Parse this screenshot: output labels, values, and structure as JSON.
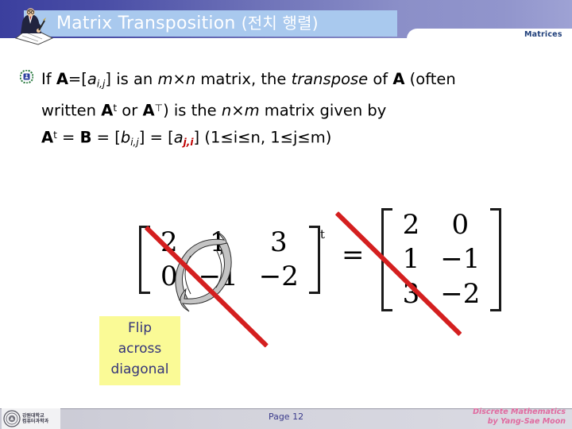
{
  "header": {
    "title_en": "Matrix Transposition",
    "title_ko": "(전치 행렬)",
    "section_label": "Matrices",
    "person_icon_name": "person-writing-icon",
    "bar_color": "#a9c9ee",
    "band_color": "#4a4ea6"
  },
  "body": {
    "bullet_icon_name": "globe-emblem-bullet-icon",
    "line1": {
      "t1": "If ",
      "A": "A",
      "eq": "=[",
      "a": "a",
      "sub": "i,j",
      "t2": "] is an ",
      "m": "m",
      "times": "×",
      "n": "n",
      "t3": " matrix, the ",
      "transpose": "transpose",
      "t4": " of ",
      "A2": "A",
      "t5": " (often"
    },
    "line2": {
      "t1": "written ",
      "A": "A",
      "supt": "t",
      "t2": " or ",
      "A2": "A",
      "supT": "⊤",
      "t3": ") is the ",
      "n": "n",
      "times": "×",
      "m": "m",
      "t4": " matrix given by"
    },
    "line3": {
      "A": "A",
      "supt": "t",
      "t1": " = ",
      "B": "B",
      "t2": " = [",
      "b": "b",
      "bsub": "i,j",
      "t3": "] = [",
      "a": "a",
      "asub": "j,i",
      "t4": "]  (1≤i≤n, 1≤j≤m)",
      "red_color": "#c00000"
    }
  },
  "equation": {
    "left_matrix": {
      "rows": [
        [
          "2",
          "1",
          "3"
        ],
        [
          "0",
          "−1",
          "−2"
        ]
      ],
      "superscript": "t"
    },
    "equals": "=",
    "right_matrix": {
      "rows": [
        [
          "2",
          "0"
        ],
        [
          "1",
          "−1"
        ],
        [
          "3",
          "−2"
        ]
      ]
    },
    "strike_color": "#d41f1f",
    "swap_arrow_name": "swap-arrows-icon"
  },
  "callout": {
    "line1": "Flip",
    "line2": "across",
    "line3": "diagonal",
    "bg_color": "#fafa96",
    "text_color": "#33337a"
  },
  "footer": {
    "logo_line1": "강원대학교",
    "logo_line2": "컴퓨터과학과",
    "page": "Page 12",
    "credit_line1": "Discrete Mathematics",
    "credit_line2": "by Yang-Sae Moon",
    "credit_color": "#e06ba0"
  }
}
